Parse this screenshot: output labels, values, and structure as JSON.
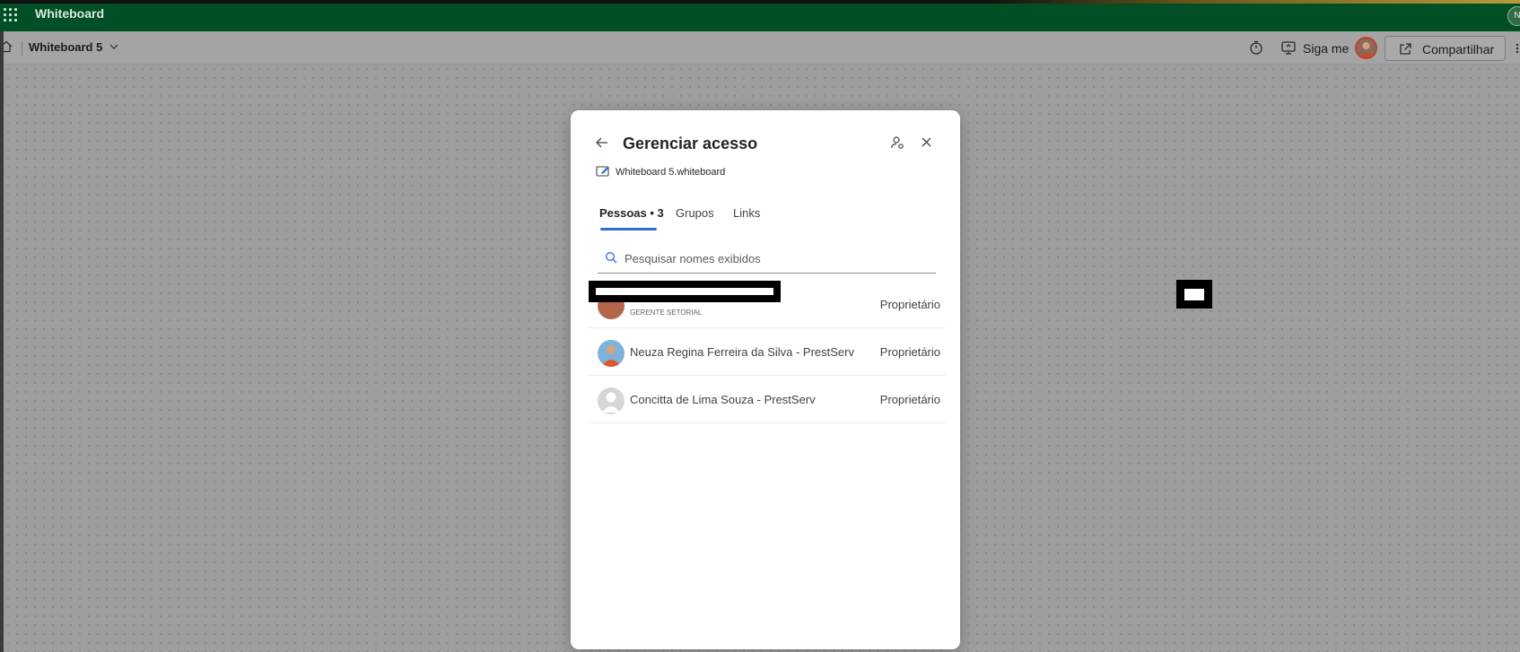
{
  "app": {
    "title": "Whiteboard",
    "user_initial": "N"
  },
  "toolbar": {
    "board_name": "Whiteboard 5",
    "follow_label": "Siga me",
    "share_label": "Compartilhar"
  },
  "dialog": {
    "title": "Gerenciar acesso",
    "file_name": "Whiteboard 5.whiteboard",
    "tabs": [
      {
        "label": "Pessoas • 3",
        "active": true
      },
      {
        "label": "Grupos",
        "active": false
      },
      {
        "label": "Links",
        "active": false
      }
    ],
    "search": {
      "placeholder": "Pesquisar nomes exibidos",
      "value": ""
    },
    "people": [
      {
        "name": "",
        "subtitle": "GERENTE SETORIAL",
        "role": "Proprietário",
        "redacted": true
      },
      {
        "name": "Neuza Regina Ferreira da Silva - PrestServ",
        "subtitle": "",
        "role": "Proprietário"
      },
      {
        "name": "Concitta de Lima Souza - PrestServ",
        "subtitle": "",
        "role": "Proprietário"
      }
    ]
  },
  "colors": {
    "appbar": "#004f25",
    "tab_accent": "#2f6ed3",
    "overlay": "#9e9e9e"
  }
}
